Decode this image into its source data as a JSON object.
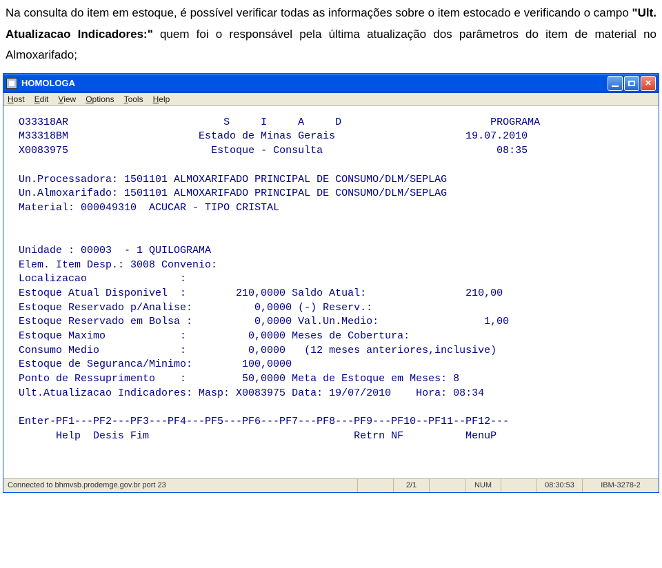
{
  "instruction": {
    "part1": "Na consulta do item em estoque, é possível verificar todas as informações sobre o item estocado e verificando o campo ",
    "bold": "\"Ult. Atualizacao Indicadores:\"",
    "part2": " quem foi o responsável pela última atualização dos parâmetros do item de material no Almoxarifado;"
  },
  "window": {
    "title": "HOMOLOGA",
    "menu": {
      "host": "Host",
      "edit": "Edit",
      "view": "View",
      "options": "Options",
      "tools": "Tools",
      "help": "Help"
    }
  },
  "screen": {
    "header": {
      "l1_left": "O33318AR",
      "l1_center": "S     I     A     D",
      "l1_right": "PROGRAMA",
      "l2_left": "M33318BM",
      "l2_center": "Estado de Minas Gerais",
      "l2_right": "19.07.2010",
      "l3_left": "X0083975",
      "l3_center": "Estoque - Consulta",
      "l3_right": "08:35"
    },
    "context": {
      "unproc_label": "Un.Processadora:",
      "unproc_value": "1501101 ALMOXARIFADO PRINCIPAL DE CONSUMO/DLM/SEPLAG",
      "unalm_label": "Un.Almoxarifado:",
      "unalm_value": "1501101 ALMOXARIFADO PRINCIPAL DE CONSUMO/DLM/SEPLAG",
      "material_label": "Material:",
      "material_value": "000049310  ACUCAR - TIPO CRISTAL"
    },
    "details": {
      "unidade": "Unidade : 00003  - 1 QUILOGRAMA",
      "elem": "Elem. Item Desp.: 3008 Convenio:",
      "localizacao": "Localizacao               :",
      "estoque_disp": "Estoque Atual Disponivel  :        210,0000 Saldo Atual:                210,00",
      "estoque_res_analise": "Estoque Reservado p/Analise:          0,0000 (-) Reserv.:",
      "estoque_res_bolsa": "Estoque Reservado em Bolsa :          0,0000 Val.Un.Medio:                 1,00",
      "estoque_max": "Estoque Maximo            :          0,0000 Meses de Cobertura:",
      "consumo_medio": "Consumo Medio             :          0,0000   (12 meses anteriores,inclusive)",
      "estoque_seg": "Estoque de Seguranca/Minimo:        100,0000",
      "ponto_resup": "Ponto de Ressuprimento    :         50,0000 Meta de Estoque em Meses: 8",
      "ult_atual": "Ult.Atualizacao Indicadores: Masp: X0083975 Data: 19/07/2010    Hora: 08:34"
    },
    "fkeys": {
      "line1": "Enter-PF1---PF2---PF3---PF4---PF5---PF6---PF7---PF8---PF9---PF10--PF11--PF12---",
      "line2": "      Help  Desis Fim                                 Retrn NF          MenuP"
    }
  },
  "status": {
    "connected": "Connected to bhmvsb.prodemge.gov.br port 23",
    "pos": "2/1",
    "num": "NUM",
    "time": "08:30:53",
    "term": "IBM-3278-2"
  }
}
